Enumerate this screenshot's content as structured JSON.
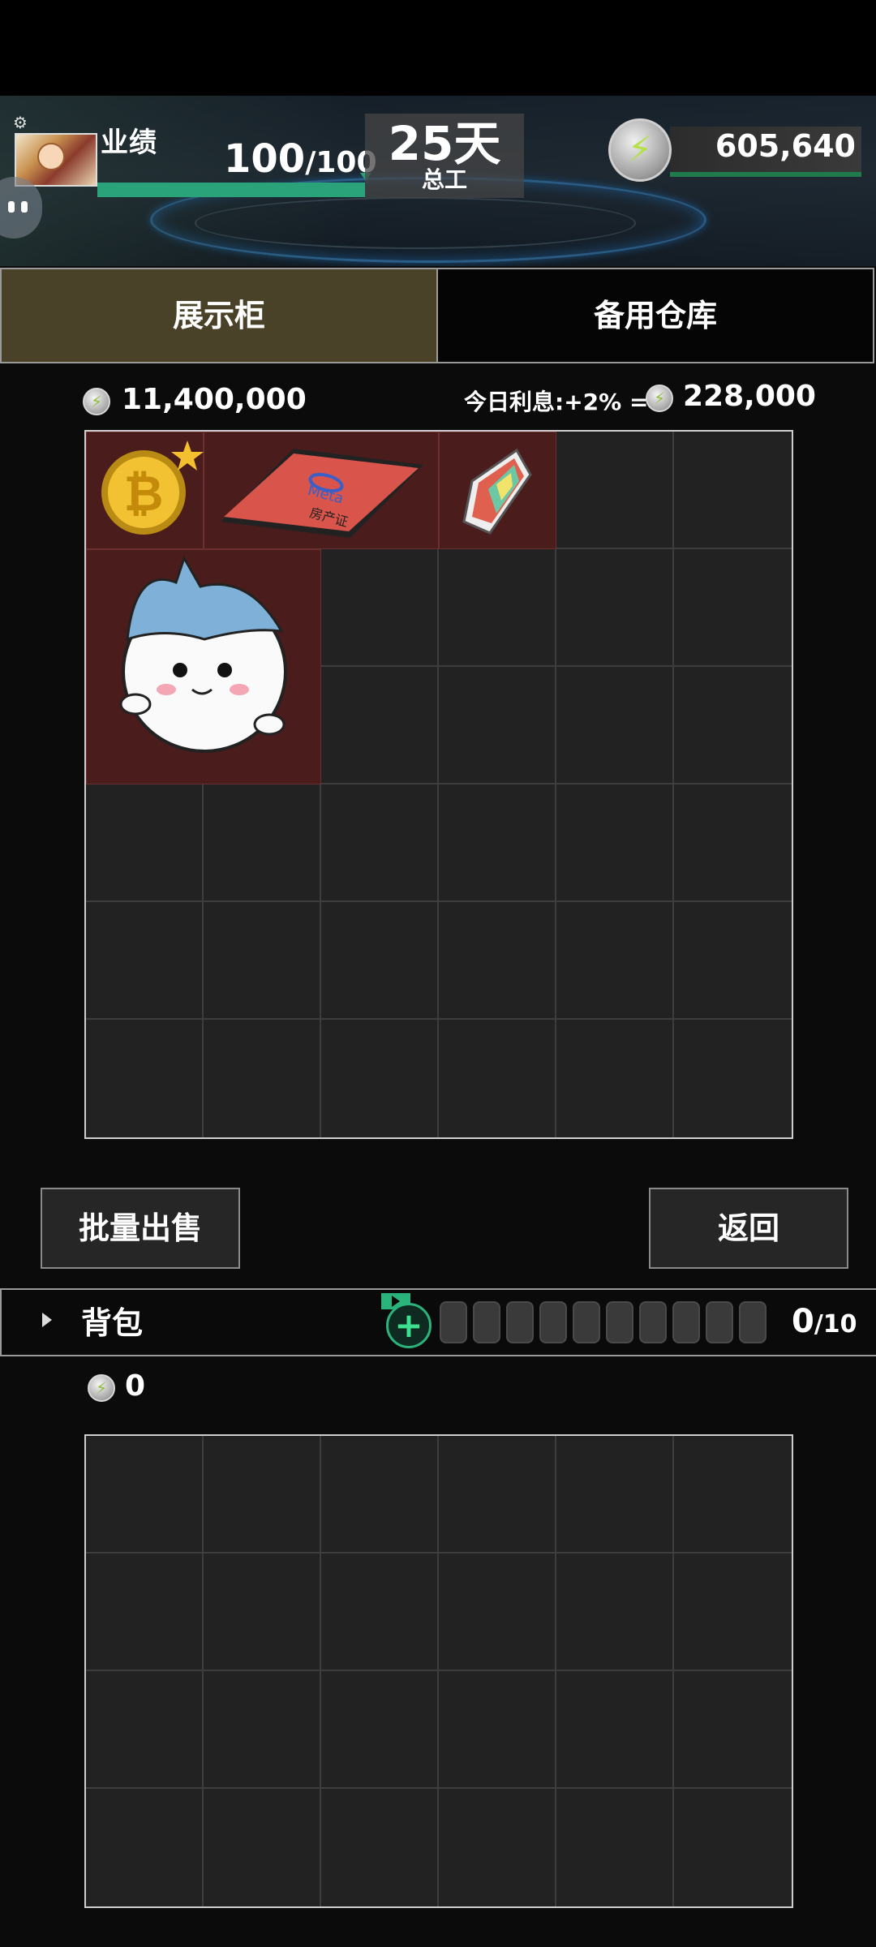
{
  "hud": {
    "performance_label": "业绩",
    "performance_current": "100",
    "performance_max": "/100",
    "performance_progress": 1.0,
    "days_value": "25天",
    "days_label": "总工",
    "coins": "605,640"
  },
  "tabs": [
    {
      "label": "展示柜",
      "active": true
    },
    {
      "label": "备用仓库",
      "active": false
    }
  ],
  "display": {
    "total_value": "11,400,000",
    "interest_text": "今日利息:+2% =",
    "interest_value": "228,000",
    "grid_cols": 6,
    "grid_rows": 6,
    "items": [
      {
        "name": "bitcoin-coin",
        "starred": true
      },
      {
        "name": "meta-property-card",
        "text_logo": "Meta",
        "text_label": "房产证"
      },
      {
        "name": "rainbow-crystal"
      },
      {
        "name": "hachiware-plush"
      }
    ]
  },
  "buttons": {
    "batch_sell": "批量出售",
    "back": "返回"
  },
  "backpack": {
    "label": "背包",
    "count": "0",
    "capacity": "/10",
    "slot_count": 10,
    "coins": "0",
    "grid_cols": 6,
    "grid_rows": 4
  },
  "colors": {
    "accent_green": "#2aa37a",
    "active_tab": "#4a4228",
    "item_bg": "#4b1c1c"
  }
}
